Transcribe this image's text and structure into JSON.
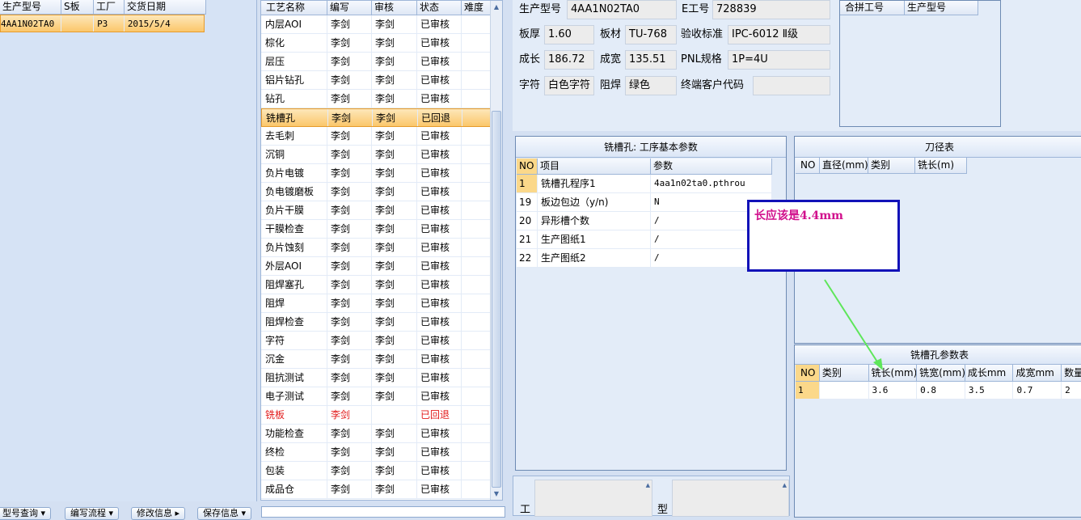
{
  "left_grid": {
    "headers": [
      "生产型号",
      "S板",
      "工厂",
      "交货日期"
    ],
    "rows": [
      {
        "model": "4AA1N02TA0",
        "s": "",
        "factory": "P3",
        "date": "2015/5/4"
      }
    ]
  },
  "bottom_buttons": [
    "型号查询 ▾",
    "编写流程 ▾",
    "修改信息 ▸",
    "保存信息 ▾"
  ],
  "process_grid": {
    "headers": [
      "工艺名称",
      "编写",
      "审核",
      "状态",
      "难度"
    ],
    "rows": [
      {
        "name": "内层AOI",
        "writer": "李剑",
        "reviewer": "李剑",
        "status": "已审核"
      },
      {
        "name": "棕化",
        "writer": "李剑",
        "reviewer": "李剑",
        "status": "已审核"
      },
      {
        "name": "层压",
        "writer": "李剑",
        "reviewer": "李剑",
        "status": "已审核"
      },
      {
        "name": "铝片钻孔",
        "writer": "李剑",
        "reviewer": "李剑",
        "status": "已审核"
      },
      {
        "name": "钻孔",
        "writer": "李剑",
        "reviewer": "李剑",
        "status": "已审核"
      },
      {
        "name": "铣槽孔",
        "writer": "李剑",
        "reviewer": "李剑",
        "status": "已回退"
      },
      {
        "name": "去毛刺",
        "writer": "李剑",
        "reviewer": "李剑",
        "status": "已审核"
      },
      {
        "name": "沉铜",
        "writer": "李剑",
        "reviewer": "李剑",
        "status": "已审核"
      },
      {
        "name": "负片电镀",
        "writer": "李剑",
        "reviewer": "李剑",
        "status": "已审核"
      },
      {
        "name": "负电镀磨板",
        "writer": "李剑",
        "reviewer": "李剑",
        "status": "已审核"
      },
      {
        "name": "负片干膜",
        "writer": "李剑",
        "reviewer": "李剑",
        "status": "已审核"
      },
      {
        "name": "干膜检查",
        "writer": "李剑",
        "reviewer": "李剑",
        "status": "已审核"
      },
      {
        "name": "负片蚀刻",
        "writer": "李剑",
        "reviewer": "李剑",
        "status": "已审核"
      },
      {
        "name": "外层AOI",
        "writer": "李剑",
        "reviewer": "李剑",
        "status": "已审核"
      },
      {
        "name": "阻焊塞孔",
        "writer": "李剑",
        "reviewer": "李剑",
        "status": "已审核"
      },
      {
        "name": "阻焊",
        "writer": "李剑",
        "reviewer": "李剑",
        "status": "已审核"
      },
      {
        "name": "阻焊检查",
        "writer": "李剑",
        "reviewer": "李剑",
        "status": "已审核"
      },
      {
        "name": "字符",
        "writer": "李剑",
        "reviewer": "李剑",
        "status": "已审核"
      },
      {
        "name": "沉金",
        "writer": "李剑",
        "reviewer": "李剑",
        "status": "已审核"
      },
      {
        "name": "阻抗测试",
        "writer": "李剑",
        "reviewer": "李剑",
        "status": "已审核"
      },
      {
        "name": "电子测试",
        "writer": "李剑",
        "reviewer": "李剑",
        "status": "已审核"
      },
      {
        "name": "铣板",
        "writer": "李剑",
        "reviewer": "",
        "status": "已回退"
      },
      {
        "name": "功能检查",
        "writer": "李剑",
        "reviewer": "李剑",
        "status": "已审核"
      },
      {
        "name": "终检",
        "writer": "李剑",
        "reviewer": "李剑",
        "status": "已审核"
      },
      {
        "name": "包装",
        "writer": "李剑",
        "reviewer": "李剑",
        "status": "已审核"
      },
      {
        "name": "成品仓",
        "writer": "李剑",
        "reviewer": "李剑",
        "status": "已审核"
      }
    ]
  },
  "info": {
    "model_label": "生产型号",
    "model_value": "4AA1N02TA0",
    "eno_label": "E工号",
    "eno_value": "728839",
    "thickness_label": "板厚",
    "thickness_value": "1.60",
    "material_label": "板材",
    "material_value": "TU-768",
    "standard_label": "验收标准",
    "standard_value": "IPC-6012 Ⅱ级",
    "length_label": "成长",
    "length_value": "186.72",
    "width_label": "成宽",
    "width_value": "135.51",
    "pnl_label": "PNL规格",
    "pnl_value": "1P=4U",
    "char_label": "字符",
    "char_value": "白色字符",
    "mask_label": "阻焊",
    "mask_value": "绿色",
    "customer_label": "终端客户代码",
    "customer_value": ""
  },
  "merge_grid": {
    "headers": [
      "合拼工号",
      "生产型号"
    ]
  },
  "params_panel": {
    "title": "铣槽孔: 工序基本参数",
    "headers": [
      "NO",
      "项目",
      "参数"
    ],
    "rows": [
      {
        "no": "1",
        "item": "铣槽孔程序1",
        "value": "4aa1n02ta0.pthrou"
      },
      {
        "no": "19",
        "item": "板边包边（y/n)",
        "value": "N"
      },
      {
        "no": "20",
        "item": "异形槽个数",
        "value": "/"
      },
      {
        "no": "21",
        "item": "生产图纸1",
        "value": "/"
      },
      {
        "no": "22",
        "item": "生产图纸2",
        "value": "/"
      }
    ]
  },
  "tool_panel": {
    "title": "刀径表",
    "headers": [
      "NO",
      "直径(mm)",
      "类别",
      "铣长(m)"
    ]
  },
  "slot_panel": {
    "title": "铣槽孔参数表",
    "headers": [
      "NO",
      "类别",
      "铣长(mm)",
      "铣宽(mm)",
      "成长mm",
      "成宽mm",
      "数量"
    ],
    "rows": [
      {
        "no": "1",
        "type": "",
        "mill_len": "3.6",
        "mill_w": "0.8",
        "len": "3.5",
        "w": "0.7",
        "qty": "2"
      }
    ]
  },
  "annotation": {
    "text": "长应该是4.4mm",
    "color": "#d10f8c",
    "arrow_color": "#5ee65a"
  },
  "bottom_labels": {
    "work": "工",
    "type": "型"
  }
}
